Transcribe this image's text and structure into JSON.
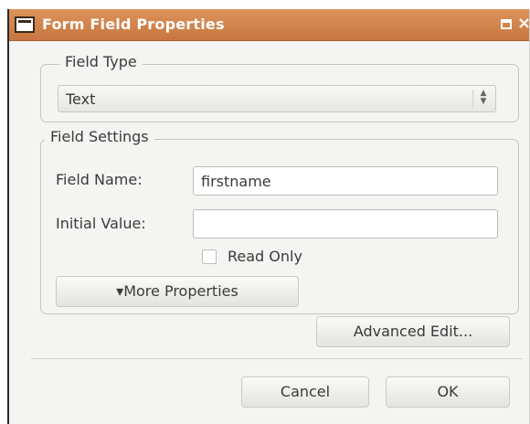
{
  "window": {
    "title": "Form Field Properties",
    "icons": {
      "app": "form-icon",
      "maximize": "maximize-icon",
      "close": "close-icon"
    },
    "close_glyph": "×"
  },
  "field_type": {
    "group_label": "Field Type",
    "selected": "Text"
  },
  "field_settings": {
    "group_label": "Field Settings",
    "name_label": "Field Name:",
    "name_value": "firstname",
    "initial_label": "Initial Value:",
    "initial_value": "",
    "read_only_label": "Read Only",
    "read_only_checked": false,
    "more_properties_label": "▾More Properties"
  },
  "buttons": {
    "advanced_edit": "Advanced Edit...",
    "cancel": "Cancel",
    "ok": "OK"
  },
  "colors": {
    "titlebar": "#d48650",
    "dialog_bg": "#f4f4f2"
  }
}
